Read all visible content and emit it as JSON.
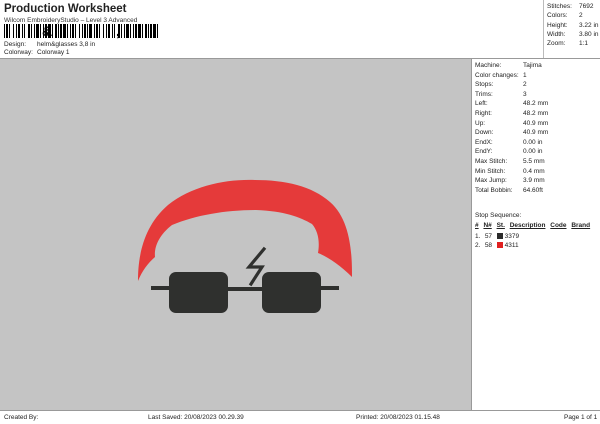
{
  "header": {
    "title": "Production Worksheet",
    "subtitle": "Wilcom EmbroideryStudio – Level 3 Advanced",
    "barcode_glyph_1": "&",
    "barcode_glyph_2": ",",
    "design_label": "Design:",
    "design_value": "helm&glasses 3,8 in",
    "colorway_label": "Colorway:",
    "colorway_value": "Colorway 1"
  },
  "stats": [
    {
      "label": "Stitches:",
      "value": "7692"
    },
    {
      "label": "Colors:",
      "value": "2"
    },
    {
      "label": "Height:",
      "value": "3.22 in"
    },
    {
      "label": "Width:",
      "value": "3.80 in"
    },
    {
      "label": "Zoom:",
      "value": "1:1"
    }
  ],
  "info": [
    {
      "label": "Machine:",
      "value": "Tajima"
    },
    {
      "label": "Color changes:",
      "value": "1"
    },
    {
      "label": "Stops:",
      "value": "2"
    },
    {
      "label": "Trims:",
      "value": "3"
    },
    {
      "label": "Left:",
      "value": "48.2 mm"
    },
    {
      "label": "Right:",
      "value": "48.2 mm"
    },
    {
      "label": "Up:",
      "value": "40.9 mm"
    },
    {
      "label": "Down:",
      "value": "40.9 mm"
    },
    {
      "label": "EndX:",
      "value": "0.00 in"
    },
    {
      "label": "EndY:",
      "value": "0.00 in"
    },
    {
      "label": "Max Stitch:",
      "value": "5.5 mm"
    },
    {
      "label": "Min Stitch:",
      "value": "0.4 mm"
    },
    {
      "label": "Max Jump:",
      "value": "3.9 mm"
    },
    {
      "label": "Total Bobbin:",
      "value": "64.60ft"
    }
  ],
  "stop_sequence": {
    "title": "Stop Sequence:",
    "columns": [
      "#",
      "N#",
      "St.",
      "Description",
      "Code",
      "Brand"
    ],
    "rows": [
      {
        "num": "1.",
        "needle": "57",
        "color": "#2b2b2b",
        "code": "3379"
      },
      {
        "num": "2.",
        "needle": "58",
        "color": "#e02020",
        "code": "4311"
      }
    ]
  },
  "design_colors": {
    "hat": "#e53a3a",
    "glasses": "#2f302e"
  },
  "footer": {
    "created_by": "Created By:",
    "last_saved": "Last Saved: 20/08/2023 00.29.39",
    "printed": "Printed: 20/08/2023 01.15.48",
    "page": "Page 1 of 1"
  }
}
